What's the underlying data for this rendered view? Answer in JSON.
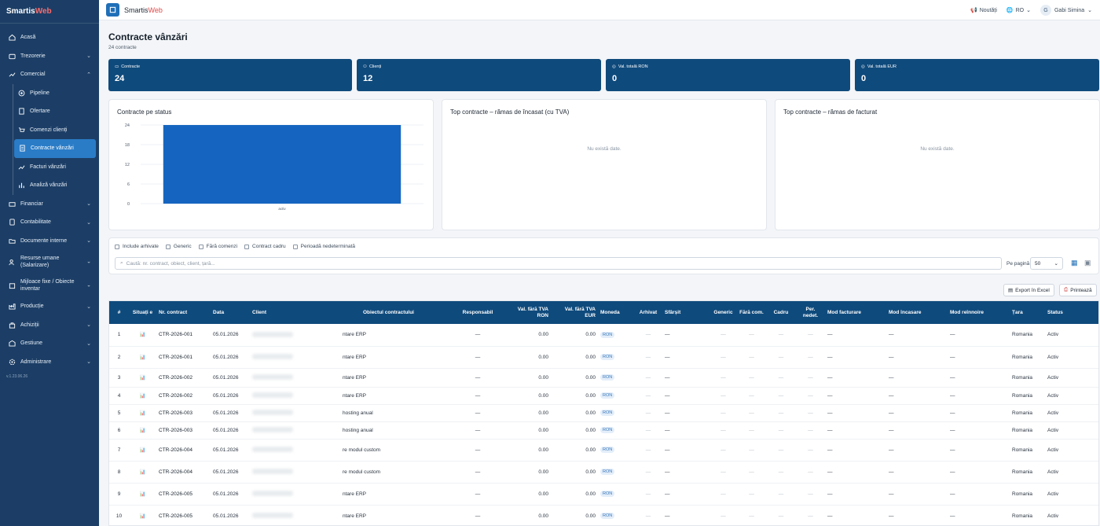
{
  "brand": {
    "part1": "Smartis",
    "part2": "Web"
  },
  "sidebar": {
    "items": [
      {
        "label": "Acasă",
        "icon": "home-icon"
      },
      {
        "label": "Trezorerie",
        "icon": "wallet-icon",
        "chevron": "⌄"
      },
      {
        "label": "Comercial",
        "icon": "trend-icon",
        "chevron": "⌃"
      }
    ],
    "subitems": [
      {
        "label": "Pipeline",
        "icon": "target-icon"
      },
      {
        "label": "Ofertare",
        "icon": "document-icon"
      },
      {
        "label": "Comenzi clienți",
        "icon": "cart-icon"
      },
      {
        "label": "Contracte vânzări",
        "icon": "contract-icon"
      },
      {
        "label": "Facturi vânzări",
        "icon": "trend-icon"
      },
      {
        "label": "Analiză vânzări",
        "icon": "bar-chart-icon"
      }
    ],
    "items2": [
      {
        "label": "Financiar",
        "icon": "finance-icon"
      },
      {
        "label": "Contabilitate",
        "icon": "calculator-icon"
      },
      {
        "label": "Documente interne",
        "icon": "folder-icon"
      },
      {
        "label": "Resurse umane (Salarizare)",
        "icon": "users-icon"
      },
      {
        "label": "Mijloace fixe / Obiecte inventar",
        "icon": "box-icon"
      },
      {
        "label": "Producție",
        "icon": "factory-icon"
      },
      {
        "label": "Achiziții",
        "icon": "bag-icon"
      },
      {
        "label": "Gestiune",
        "icon": "warehouse-icon"
      },
      {
        "label": "Administrare",
        "icon": "gear-icon"
      }
    ],
    "version": "v.1.23.06.26"
  },
  "topbar": {
    "app_name": "Smartis",
    "app_name_accent": "Web",
    "news": "Noutăți",
    "lang": "RO",
    "user_initial": "G",
    "user": "Gabi Simina"
  },
  "page": {
    "title": "Contracte vânzări",
    "subtitle": "24 contracte"
  },
  "kpis": [
    {
      "label": "Contracte",
      "value": "24",
      "icon": "document-icon"
    },
    {
      "label": "Clienți",
      "value": "12",
      "icon": "users-icon"
    },
    {
      "label": "Val. totală RON",
      "value": "0",
      "icon": "money-icon"
    },
    {
      "label": "Val. totală EUR",
      "value": "0",
      "icon": "money-icon"
    }
  ],
  "panels": {
    "status_title": "Contracte pe status",
    "top1_title": "Top contracte – rămas de încasat (cu TVA)",
    "top2_title": "Top contracte – rămas de facturat",
    "no_data": "Nu există date."
  },
  "chart_data": {
    "type": "bar",
    "categories": [
      "activ"
    ],
    "values": [
      24
    ],
    "ylim": [
      0,
      24
    ],
    "yticks": [
      "24",
      "18",
      "12",
      "6",
      "0"
    ],
    "color": "#1565c0"
  },
  "filters": {
    "checkboxes": [
      "Include arhivate",
      "Generic",
      "Fără comenzi",
      "Contract cadru",
      "Perioadă nedeterminată"
    ],
    "search_placeholder": "Caută: nr. contract, obiect, client, țară...",
    "per_page_label": "Pe pagină",
    "per_page_value": "50"
  },
  "actions": {
    "export": "Export în Excel",
    "print": "Printează"
  },
  "table": {
    "headers": [
      "#",
      "Situați e",
      "Nr. contract",
      "Data",
      "Client",
      "Obiectul contractului",
      "Responsabil",
      "Val. fără TVA RON",
      "Val. fără TVA EUR",
      "Moneda",
      "Arhivat",
      "Sfârșit",
      "Generic",
      "Fără com.",
      "Cadru",
      "Per. nedet.",
      "Mod facturare",
      "Mod încasare",
      "Mod reînnoire",
      "Țara",
      "Status"
    ],
    "rows": [
      {
        "n": "1",
        "nr": "CTR-2026-001",
        "data": "05.01.2026",
        "obiect": "ntare ERP",
        "resp": "—",
        "ron": "0.00",
        "eur": "0.00",
        "moneda": "RON",
        "arhivat": "—",
        "sfarsit": "—",
        "generic": "—",
        "fara": "—",
        "cadru": "—",
        "pernedet": "—",
        "modfact": "—",
        "modinc": "—",
        "modren": "—",
        "tara": "Romania",
        "status": "Activ"
      },
      {
        "n": "2",
        "nr": "CTR-2026-001",
        "data": "05.01.2026",
        "obiect": "ntare ERP",
        "resp": "—",
        "ron": "0.00",
        "eur": "0.00",
        "moneda": "RON",
        "arhivat": "—",
        "sfarsit": "—",
        "generic": "—",
        "fara": "—",
        "cadru": "—",
        "pernedet": "—",
        "modfact": "—",
        "modinc": "—",
        "modren": "—",
        "tara": "Romania",
        "status": "Activ"
      },
      {
        "n": "3",
        "nr": "CTR-2026-002",
        "data": "05.01.2026",
        "obiect": "ntare ERP",
        "resp": "—",
        "ron": "0.00",
        "eur": "0.00",
        "moneda": "RON",
        "arhivat": "—",
        "sfarsit": "—",
        "generic": "—",
        "fara": "—",
        "cadru": "—",
        "pernedet": "—",
        "modfact": "—",
        "modinc": "—",
        "modren": "—",
        "tara": "Romania",
        "status": "Activ"
      },
      {
        "n": "4",
        "nr": "CTR-2026-002",
        "data": "05.01.2026",
        "obiect": "ntare ERP",
        "resp": "—",
        "ron": "0.00",
        "eur": "0.00",
        "moneda": "RON",
        "arhivat": "—",
        "sfarsit": "—",
        "generic": "—",
        "fara": "—",
        "cadru": "—",
        "pernedet": "—",
        "modfact": "—",
        "modinc": "—",
        "modren": "—",
        "tara": "Romania",
        "status": "Activ"
      },
      {
        "n": "5",
        "nr": "CTR-2026-003",
        "data": "05.01.2026",
        "obiect": "hosting anual",
        "resp": "—",
        "ron": "0.00",
        "eur": "0.00",
        "moneda": "RON",
        "arhivat": "—",
        "sfarsit": "—",
        "generic": "—",
        "fara": "—",
        "cadru": "—",
        "pernedet": "—",
        "modfact": "—",
        "modinc": "—",
        "modren": "—",
        "tara": "Romania",
        "status": "Activ"
      },
      {
        "n": "6",
        "nr": "CTR-2026-003",
        "data": "05.01.2026",
        "obiect": "hosting anual",
        "resp": "—",
        "ron": "0.00",
        "eur": "0.00",
        "moneda": "RON",
        "arhivat": "—",
        "sfarsit": "—",
        "generic": "—",
        "fara": "—",
        "cadru": "—",
        "pernedet": "—",
        "modfact": "—",
        "modinc": "—",
        "modren": "—",
        "tara": "Romania",
        "status": "Activ"
      },
      {
        "n": "7",
        "nr": "CTR-2026-004",
        "data": "05.01.2026",
        "obiect": "re modul custom",
        "resp": "—",
        "ron": "0.00",
        "eur": "0.00",
        "moneda": "RON",
        "arhivat": "—",
        "sfarsit": "—",
        "generic": "—",
        "fara": "—",
        "cadru": "—",
        "pernedet": "—",
        "modfact": "—",
        "modinc": "—",
        "modren": "—",
        "tara": "Romania",
        "status": "Activ"
      },
      {
        "n": "8",
        "nr": "CTR-2026-004",
        "data": "05.01.2026",
        "obiect": "re modul custom",
        "resp": "—",
        "ron": "0.00",
        "eur": "0.00",
        "moneda": "RON",
        "arhivat": "—",
        "sfarsit": "—",
        "generic": "—",
        "fara": "—",
        "cadru": "—",
        "pernedet": "—",
        "modfact": "—",
        "modinc": "—",
        "modren": "—",
        "tara": "Romania",
        "status": "Activ"
      },
      {
        "n": "9",
        "nr": "CTR-2026-005",
        "data": "05.01.2026",
        "obiect": "ntare ERP",
        "resp": "—",
        "ron": "0.00",
        "eur": "0.00",
        "moneda": "RON",
        "arhivat": "—",
        "sfarsit": "—",
        "generic": "—",
        "fara": "—",
        "cadru": "—",
        "pernedet": "—",
        "modfact": "—",
        "modinc": "—",
        "modren": "—",
        "tara": "Romania",
        "status": "Activ"
      },
      {
        "n": "10",
        "nr": "CTR-2026-005",
        "data": "05.01.2026",
        "obiect": "ntare ERP",
        "resp": "—",
        "ron": "0.00",
        "eur": "0.00",
        "moneda": "RON",
        "arhivat": "—",
        "sfarsit": "—",
        "generic": "—",
        "fara": "—",
        "cadru": "—",
        "pernedet": "—",
        "modfact": "—",
        "modinc": "—",
        "modren": "—",
        "tara": "Romania",
        "status": "Activ"
      }
    ]
  }
}
